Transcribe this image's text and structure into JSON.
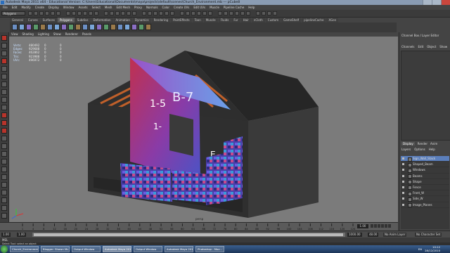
{
  "window": {
    "title": "Autodesk Maya 2011 x64 - Educational Version: C:\\Users\\Educational\\Documents\\maya\\projects\\default\\scenes\\Church_Environment.mb --- pCube8",
    "minimize": "",
    "maximize": "",
    "close": ""
  },
  "menubar": [
    "File",
    "Edit",
    "Modify",
    "Create",
    "Display",
    "Window",
    "Assets",
    "Select",
    "Mesh",
    "Edit Mesh",
    "Proxy",
    "Normals",
    "Color",
    "Create UVs",
    "Edit UVs",
    "Muscle",
    "Pipeline Cache",
    "Help"
  ],
  "status": {
    "mode": "Polygons"
  },
  "shelf": {
    "tabs": [
      "General",
      "Curves",
      "Surfaces",
      "Polygons",
      "Subdivs",
      "Deformation",
      "Animation",
      "Dynamics",
      "Rendering",
      "PaintEffects",
      "Toon",
      "Muscle",
      "Fluids",
      "Fur",
      "Hair",
      "nCloth",
      "Custom",
      "GameShelf",
      "pipelineCache",
      "XGen"
    ],
    "active": "Polygons",
    "icons": [
      "sphere",
      "cube",
      "cylinder",
      "cone",
      "plane",
      "torus",
      "combine",
      "separate",
      "smooth",
      "extrude",
      "bridge",
      "merge",
      "split",
      "wedge",
      "bevel",
      "fill",
      "booleans",
      "mirror",
      "reduce",
      "smooth-proxy"
    ]
  },
  "panel": {
    "menu": [
      "View",
      "Shading",
      "Lighting",
      "Show",
      "Renderer",
      "Panels"
    ]
  },
  "hud": {
    "rows": [
      {
        "label": "Verts:",
        "a": "480492",
        "b": "0",
        "c": "0"
      },
      {
        "label": "Edges:",
        "a": "929688",
        "b": "0",
        "c": "0"
      },
      {
        "label": "Faces:",
        "a": "462862",
        "b": "0",
        "c": "0"
      },
      {
        "label": "Tris:",
        "a": "923988",
        "b": "0",
        "c": "0"
      },
      {
        "label": "UVs:",
        "a": "496972",
        "b": "0",
        "c": "0"
      }
    ]
  },
  "viewport": {
    "camera": "persp",
    "wall_texts": [
      "B-7",
      "1-5",
      "B-",
      "1-",
      "E"
    ]
  },
  "channelbox": {
    "title": "Channel Box / Layer Editor",
    "menu": [
      "Channels",
      "Edit",
      "Object",
      "Show"
    ]
  },
  "layers": {
    "tabs": [
      "Display",
      "Render",
      "Anim"
    ],
    "active_tab": "Display",
    "menu": [
      "Layers",
      "Options",
      "Help"
    ],
    "items": [
      {
        "name": "Sign_Wall_Stack",
        "selected": true
      },
      {
        "name": "Shaped_Beam",
        "selected": false
      },
      {
        "name": "Windows",
        "selected": false
      },
      {
        "name": "Beams",
        "selected": false
      },
      {
        "name": "Shape",
        "selected": false
      },
      {
        "name": "Fence",
        "selected": false
      },
      {
        "name": "Front_W",
        "selected": false
      },
      {
        "name": "Side_W",
        "selected": false
      },
      {
        "name": "Image_Planes",
        "selected": false
      }
    ]
  },
  "timeline": {
    "ticks": [
      "1",
      "4",
      "8",
      "12",
      "16",
      "20",
      "24",
      "28",
      "32",
      "36",
      "40",
      "44",
      "48",
      "52",
      "56",
      "60",
      "64",
      "68",
      "72",
      "76",
      "80",
      "84",
      "88",
      "92",
      "96",
      "100",
      "104",
      "108",
      "112",
      "116",
      "120",
      "124"
    ],
    "current_frame": "1.00"
  },
  "range": {
    "start": "1.00",
    "inner_start": "1.00",
    "inner_end": "24.00",
    "end_a": "1000.00",
    "end_b": "48.00",
    "anim_layer": "No Anim Layer",
    "char_set": "No Character Set"
  },
  "cmd": {
    "label": "MEL",
    "help": "Select Tool: select an object"
  },
  "taskbar": {
    "items": [
      {
        "label": "Church_Environment",
        "active": false
      },
      {
        "label": "Blogger: Shawn Mc...",
        "active": false
      },
      {
        "label": "Output Window",
        "active": false
      },
      {
        "label": "Autodesk Maya 201...",
        "active": true
      },
      {
        "label": "Output Window",
        "active": false
      },
      {
        "label": "Autodesk Maya 201...",
        "active": false
      },
      {
        "label": "Photoshop - Moz...",
        "active": false
      }
    ],
    "language": "EN",
    "time": "10:12",
    "date": "28/12/2010"
  },
  "colors": {
    "viewport_bg": "#7b7b7b",
    "selection_blue": "#5b7fbc",
    "task_blue": "#1c3558"
  }
}
